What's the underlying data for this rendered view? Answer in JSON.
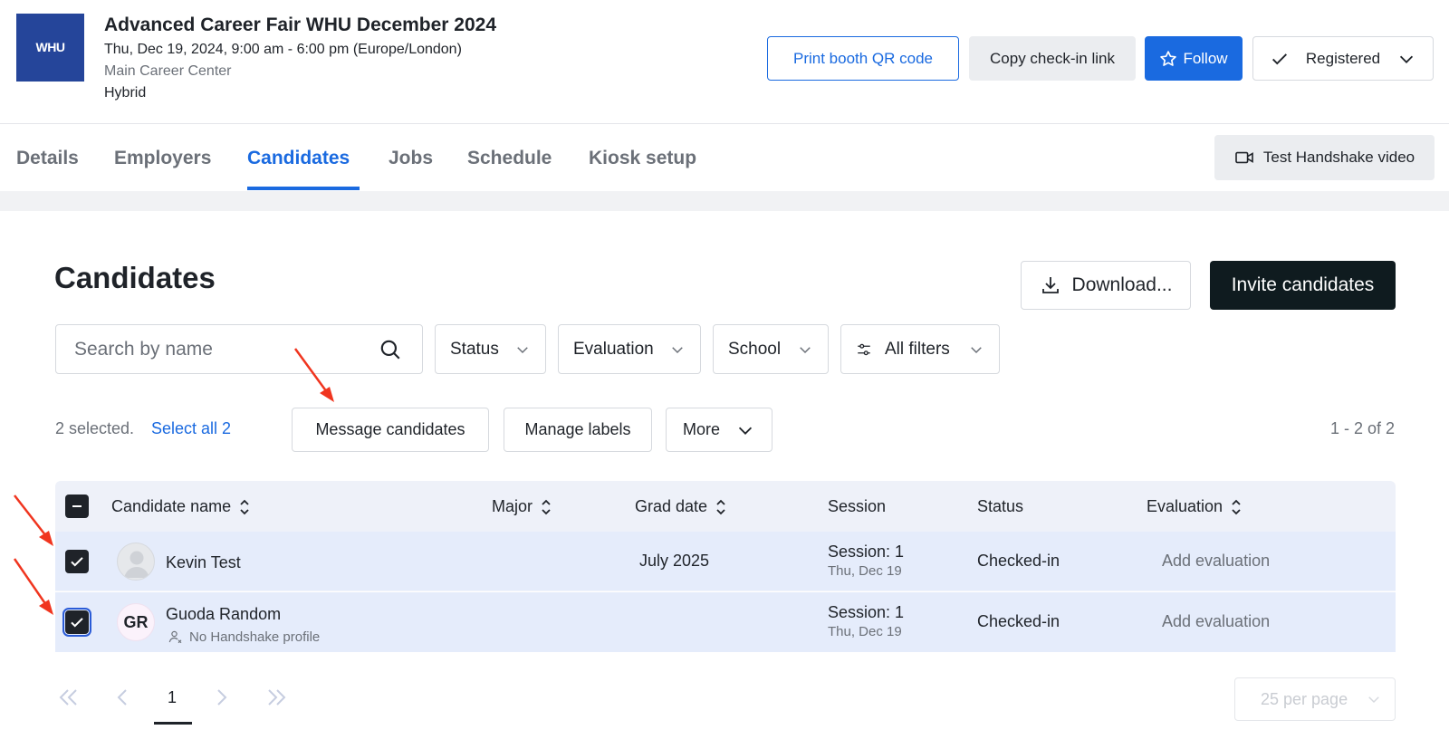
{
  "event": {
    "logo_text": "WHU",
    "title": "Advanced Career Fair WHU December 2024",
    "date": "Thu, Dec 19, 2024, 9:00 am - 6:00 pm (Europe/London)",
    "location": "Main Career Center",
    "mode": "Hybrid"
  },
  "header_actions": {
    "print_qr": "Print booth QR code",
    "copy_link": "Copy check-in link",
    "follow": "Follow",
    "registered": "Registered"
  },
  "tabs": [
    {
      "label": "Details"
    },
    {
      "label": "Employers"
    },
    {
      "label": "Candidates",
      "active": true
    },
    {
      "label": "Jobs"
    },
    {
      "label": "Schedule"
    },
    {
      "label": "Kiosk setup"
    }
  ],
  "test_video": "Test Handshake video",
  "page": {
    "title": "Candidates",
    "download": "Download...",
    "invite": "Invite candidates"
  },
  "search": {
    "placeholder": "Search by name",
    "value": ""
  },
  "filters": {
    "status": "Status",
    "evaluation": "Evaluation",
    "school": "School",
    "all": "All filters"
  },
  "selection": {
    "count_text": "2 selected.",
    "select_all": "Select all 2",
    "message": "Message candidates",
    "labels": "Manage labels",
    "more": "More",
    "range": "1 - 2 of 2"
  },
  "table": {
    "headers": {
      "name": "Candidate name",
      "major": "Major",
      "grad": "Grad date",
      "session": "Session",
      "status": "Status",
      "evaluation": "Evaluation"
    },
    "rows": [
      {
        "name": "Kevin Test",
        "major": "",
        "grad": "July 2025",
        "session": "Session: 1",
        "session_date": "Thu, Dec 19",
        "status": "Checked-in",
        "evaluation": "Add evaluation",
        "checked": true
      },
      {
        "name": "Guoda Random",
        "initials": "GR",
        "note": "No Handshake profile",
        "major": "",
        "grad": "",
        "session": "Session: 1",
        "session_date": "Thu, Dec 19",
        "status": "Checked-in",
        "evaluation": "Add evaluation",
        "checked": true
      }
    ]
  },
  "pagination": {
    "current_page": "1",
    "per_page": "25 per page"
  },
  "colors": {
    "accent": "#1a6ae0",
    "invite_bg": "#0f1b1f",
    "row_selected": "#e5ecfb",
    "annotation_arrow": "#f0351f"
  }
}
